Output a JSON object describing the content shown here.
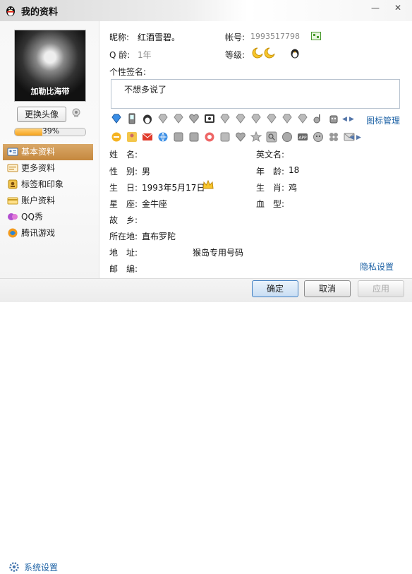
{
  "window": {
    "title": "我的资料",
    "minimize": "—",
    "close": "✕"
  },
  "left": {
    "avatar_caption": "加勒比海带",
    "change_avatar": "更换头像",
    "progress_value": 0.39,
    "progress_text": "39%",
    "nav": [
      {
        "label": "基本资料",
        "icon": "profile-card-icon",
        "active": true
      },
      {
        "label": "更多资料",
        "icon": "more-info-icon",
        "active": false
      },
      {
        "label": "标签和印象",
        "icon": "tag-icon",
        "active": false
      },
      {
        "label": "账户资料",
        "icon": "account-icon",
        "active": false
      },
      {
        "label": "QQ秀",
        "icon": "qq-show-icon",
        "active": false
      },
      {
        "label": "腾讯游戏",
        "icon": "tencent-games-icon",
        "active": false
      }
    ],
    "settings": "系统设置"
  },
  "profile": {
    "nickname_label": "昵称:",
    "nickname": "红酒雪碧。",
    "account_label": "帐号:",
    "account": "1993517798",
    "qage_label": "Q 龄:",
    "qage": "1年",
    "level_label": "等级:",
    "signature_label": "个性签名:",
    "signature": "不想多说了",
    "badge_manage": "图标管理"
  },
  "details": {
    "name_label": "姓　名:",
    "name": "",
    "english_label": "英文名:",
    "english": "",
    "gender_label": "性　别:",
    "gender": "男",
    "age_label": "年　龄:",
    "age": "18",
    "birthday_label": "生　日:",
    "birthday": "1993年5月17日",
    "zodiac_label": "生　肖:",
    "zodiac": "鸡",
    "star_label": "星　座:",
    "star": "金牛座",
    "blood_label": "血　型:",
    "blood": "",
    "hometown_label": "故　乡:",
    "hometown": "",
    "location_label": "所在地:",
    "location": "直布罗陀",
    "address_label": "地　址:",
    "address": "猴岛专用号码",
    "postcode_label": "邮　编:",
    "postcode": "",
    "privacy": "隐私设置"
  },
  "footer": {
    "ok": "确定",
    "cancel": "取消",
    "apply": "应用"
  },
  "colors": {
    "accent": "#1d62a5",
    "nav_active": "#c5883e",
    "progress": "#f6a21a"
  }
}
